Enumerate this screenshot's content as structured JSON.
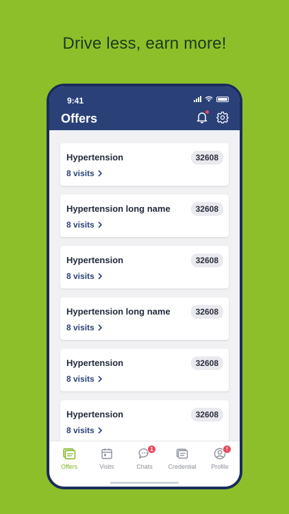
{
  "headline": "Drive less, earn more!",
  "status": {
    "time": "9:41"
  },
  "header": {
    "title": "Offers"
  },
  "offers": [
    {
      "name": "Hypertension",
      "code": "32608",
      "visits": "8 visits"
    },
    {
      "name": "Hypertension long name",
      "code": "32608",
      "visits": "8 visits"
    },
    {
      "name": "Hypertension",
      "code": "32608",
      "visits": "8 visits"
    },
    {
      "name": "Hypertension long name",
      "code": "32608",
      "visits": "8 visits"
    },
    {
      "name": "Hypertension",
      "code": "32608",
      "visits": "8 visits"
    },
    {
      "name": "Hypertension",
      "code": "32608",
      "visits": "8 visits"
    }
  ],
  "tabs": [
    {
      "label": "Offers",
      "icon": "offers-icon",
      "active": true
    },
    {
      "label": "Visits",
      "icon": "calendar-icon"
    },
    {
      "label": "Chats",
      "icon": "chat-icon",
      "badge": "1"
    },
    {
      "label": "Credential",
      "icon": "credential-icon"
    },
    {
      "label": "Profile",
      "icon": "profile-icon",
      "badge": "!"
    }
  ],
  "colors": {
    "background": "#8dbf2a",
    "header": "#2a4178",
    "accent": "#7fb320",
    "badge": "#e84a5f"
  }
}
